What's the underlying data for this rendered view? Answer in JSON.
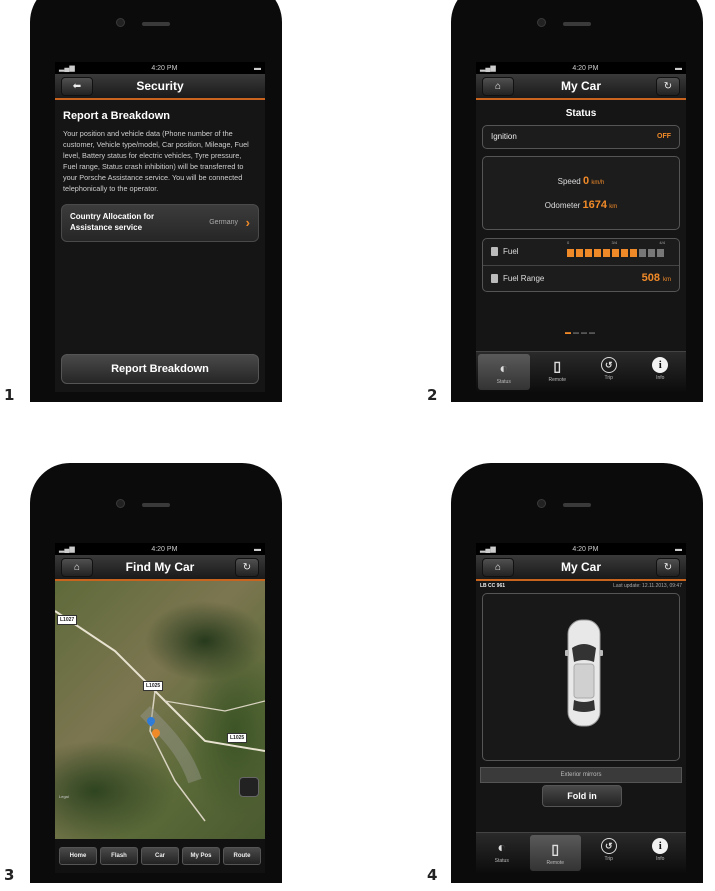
{
  "panels": [
    {
      "number": "1",
      "status": {
        "time": "4:20 PM"
      },
      "nav": {
        "title": "Security",
        "back_icon": "back-arrow-icon"
      },
      "heading": "Report a Breakdown",
      "body": "Your position and vehicle data (Phone number of the customer, Vehicle type/model, Car position, Mileage, Fuel level, Battery status for electric vehicles, Tyre pressure, Fuel range, Status crash inhibition) will be transferred to your Porsche Assistance service. You will be connected telephonically to the operator.",
      "country_label": "Country Allocation for Assistance service",
      "country_value": "Germany",
      "button": "Report Breakdown"
    },
    {
      "number": "2",
      "status": {
        "time": "4:20 PM"
      },
      "nav": {
        "title": "My Car",
        "home_icon": "home-icon",
        "refresh_icon": "refresh-icon"
      },
      "section": "Status",
      "ignition_label": "Ignition",
      "ignition_value": "OFF",
      "speed_label": "Speed",
      "speed_value": "0",
      "speed_unit": "km/h",
      "odometer_label": "Odometer",
      "odometer_value": "1674",
      "odometer_unit": "km",
      "fuel_label": "Fuel",
      "fuel_ticks": [
        "0",
        "3/4",
        "4/4"
      ],
      "fuel_level": 0.75,
      "fuel_range_label": "Fuel Range",
      "fuel_range_value": "508",
      "fuel_range_unit": "km",
      "tabs": [
        {
          "label": "Status",
          "icon": "gauge-icon",
          "selected": true
        },
        {
          "label": "Remote",
          "icon": "phone-remote-icon",
          "selected": false
        },
        {
          "label": "Trip",
          "icon": "trip-icon",
          "selected": false
        },
        {
          "label": "Info",
          "icon": "info-icon",
          "selected": false
        }
      ]
    },
    {
      "number": "3",
      "status": {
        "time": "4:20 PM"
      },
      "nav": {
        "title": "Find My Car",
        "home_icon": "home-icon",
        "refresh_icon": "refresh-icon"
      },
      "map_labels": [
        "L1027",
        "L1025",
        "L1025"
      ],
      "map_legal": "Legal",
      "buttons": [
        "Home",
        "Flash",
        "Car",
        "My Pos",
        "Route"
      ]
    },
    {
      "number": "4",
      "status": {
        "time": "4:20 PM"
      },
      "nav": {
        "title": "My Car",
        "home_icon": "home-icon",
        "refresh_icon": "refresh-icon"
      },
      "plate": "LB CC 961",
      "last_update": "Last update: 12.11.2013, 09:47",
      "mirrors_label": "Exterior mirrors",
      "fold_button": "Fold in",
      "tabs": [
        {
          "label": "Status",
          "icon": "gauge-icon",
          "selected": false
        },
        {
          "label": "Remote",
          "icon": "phone-remote-icon",
          "selected": true
        },
        {
          "label": "Trip",
          "icon": "trip-icon",
          "selected": false
        },
        {
          "label": "Info",
          "icon": "info-icon",
          "selected": false
        }
      ]
    }
  ],
  "colors": {
    "accent": "#f08a28",
    "screen_bg": "#151515"
  }
}
